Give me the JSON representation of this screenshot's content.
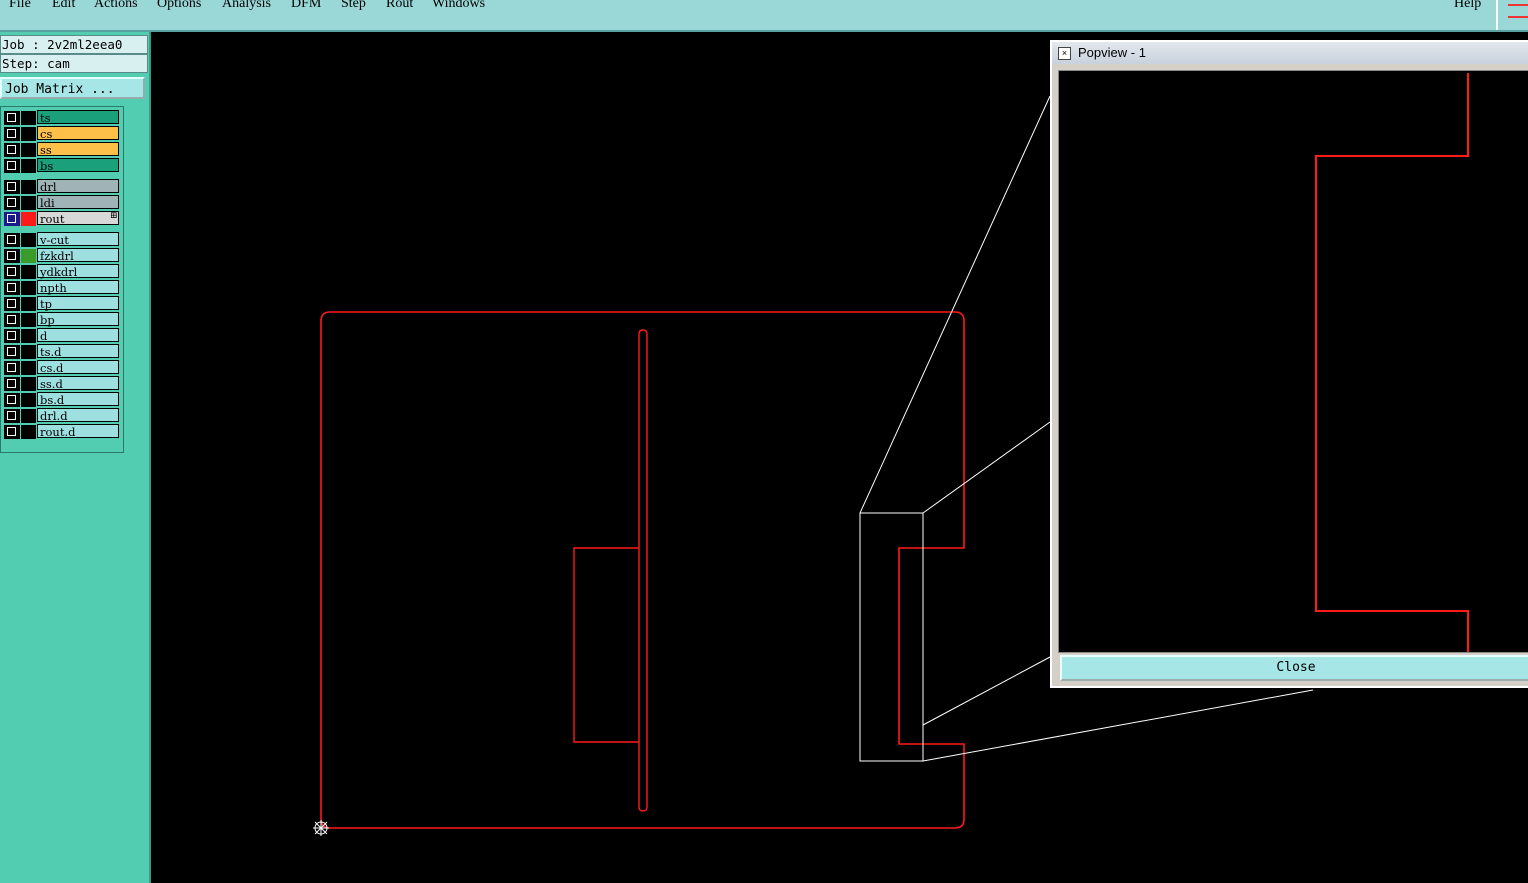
{
  "menu": {
    "items": [
      {
        "label": "File"
      },
      {
        "label": "Edit"
      },
      {
        "label": "Actions"
      },
      {
        "label": "Options"
      },
      {
        "label": "Analysis"
      },
      {
        "label": "DFM"
      },
      {
        "label": "Step"
      },
      {
        "label": "Rout"
      },
      {
        "label": "Windows"
      }
    ],
    "help": "Help"
  },
  "job": {
    "job_label": "Job : 2v2ml2eea0",
    "step_label": "Step: cam",
    "matrix_button": "Job Matrix ..."
  },
  "layers": [
    {
      "name": "ts",
      "bg": "#1aa07a",
      "swatch": "#000000",
      "checked": false
    },
    {
      "name": "cs",
      "bg": "#ffc04a",
      "swatch": "#000000",
      "checked": false
    },
    {
      "name": "ss",
      "bg": "#ffc04a",
      "swatch": "#000000",
      "checked": false
    },
    {
      "name": "bs",
      "bg": "#1aa07a",
      "swatch": "#000000",
      "checked": false
    },
    {
      "name": "drl",
      "bg": "#a0b4b8",
      "swatch": "#000000",
      "checked": false
    },
    {
      "name": "ldi",
      "bg": "#a0b4b8",
      "swatch": "#000000",
      "checked": false
    },
    {
      "name": "rout",
      "bg": "#d8d8d8",
      "swatch": "#ff1a1a",
      "checked": true
    },
    {
      "name": "v-cut",
      "bg": "#9ee0e0",
      "swatch": "#000000",
      "checked": false
    },
    {
      "name": "fzkdrl",
      "bg": "#9ee0e0",
      "swatch": "#3a9a2a",
      "checked": false
    },
    {
      "name": "ydkdrl",
      "bg": "#9ee0e0",
      "swatch": "#000000",
      "checked": false
    },
    {
      "name": "npth",
      "bg": "#9ee0e0",
      "swatch": "#000000",
      "checked": false
    },
    {
      "name": "tp",
      "bg": "#9ee0e0",
      "swatch": "#000000",
      "checked": false
    },
    {
      "name": "bp",
      "bg": "#9ee0e0",
      "swatch": "#000000",
      "checked": false
    },
    {
      "name": "d",
      "bg": "#9ee0e0",
      "swatch": "#000000",
      "checked": false
    },
    {
      "name": "ts.d",
      "bg": "#9ee0e0",
      "swatch": "#000000",
      "checked": false
    },
    {
      "name": "cs.d",
      "bg": "#9ee0e0",
      "swatch": "#000000",
      "checked": false
    },
    {
      "name": "ss.d",
      "bg": "#9ee0e0",
      "swatch": "#000000",
      "checked": false
    },
    {
      "name": "bs.d",
      "bg": "#9ee0e0",
      "swatch": "#000000",
      "checked": false
    },
    {
      "name": "drl.d",
      "bg": "#9ee0e0",
      "swatch": "#000000",
      "checked": false
    },
    {
      "name": "rout.d",
      "bg": "#9ee0e0",
      "swatch": "#000000",
      "checked": false
    }
  ],
  "popview": {
    "title": "Popview - 1",
    "close_label": "Close"
  },
  "colors": {
    "rout_line": "#ff1a1a",
    "zoom_frame": "#ffffff",
    "canvas_bg": "#000000",
    "panel_bg": "#52cdb1",
    "menubar_bg": "#9ad7d7"
  }
}
